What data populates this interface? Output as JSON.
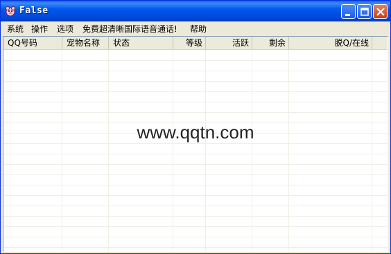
{
  "window": {
    "title": "False"
  },
  "menu": {
    "items": [
      "系统",
      "操作",
      "选项",
      "免费超清晰国际语音通话!",
      "帮助"
    ]
  },
  "table": {
    "columns": [
      {
        "label": "QQ号码",
        "align": "left"
      },
      {
        "label": "宠物名称",
        "align": "left"
      },
      {
        "label": "状态",
        "align": "left"
      },
      {
        "label": "等级",
        "align": "right"
      },
      {
        "label": "活跃",
        "align": "right"
      },
      {
        "label": "剩余",
        "align": "right"
      },
      {
        "label": "脱Q/在线",
        "align": "right"
      }
    ],
    "rows": []
  },
  "watermark": "www.qqtn.com",
  "colors": {
    "titlebar": "#0058ee",
    "menubar": "#ece9d8",
    "close_button": "#c9411b"
  }
}
